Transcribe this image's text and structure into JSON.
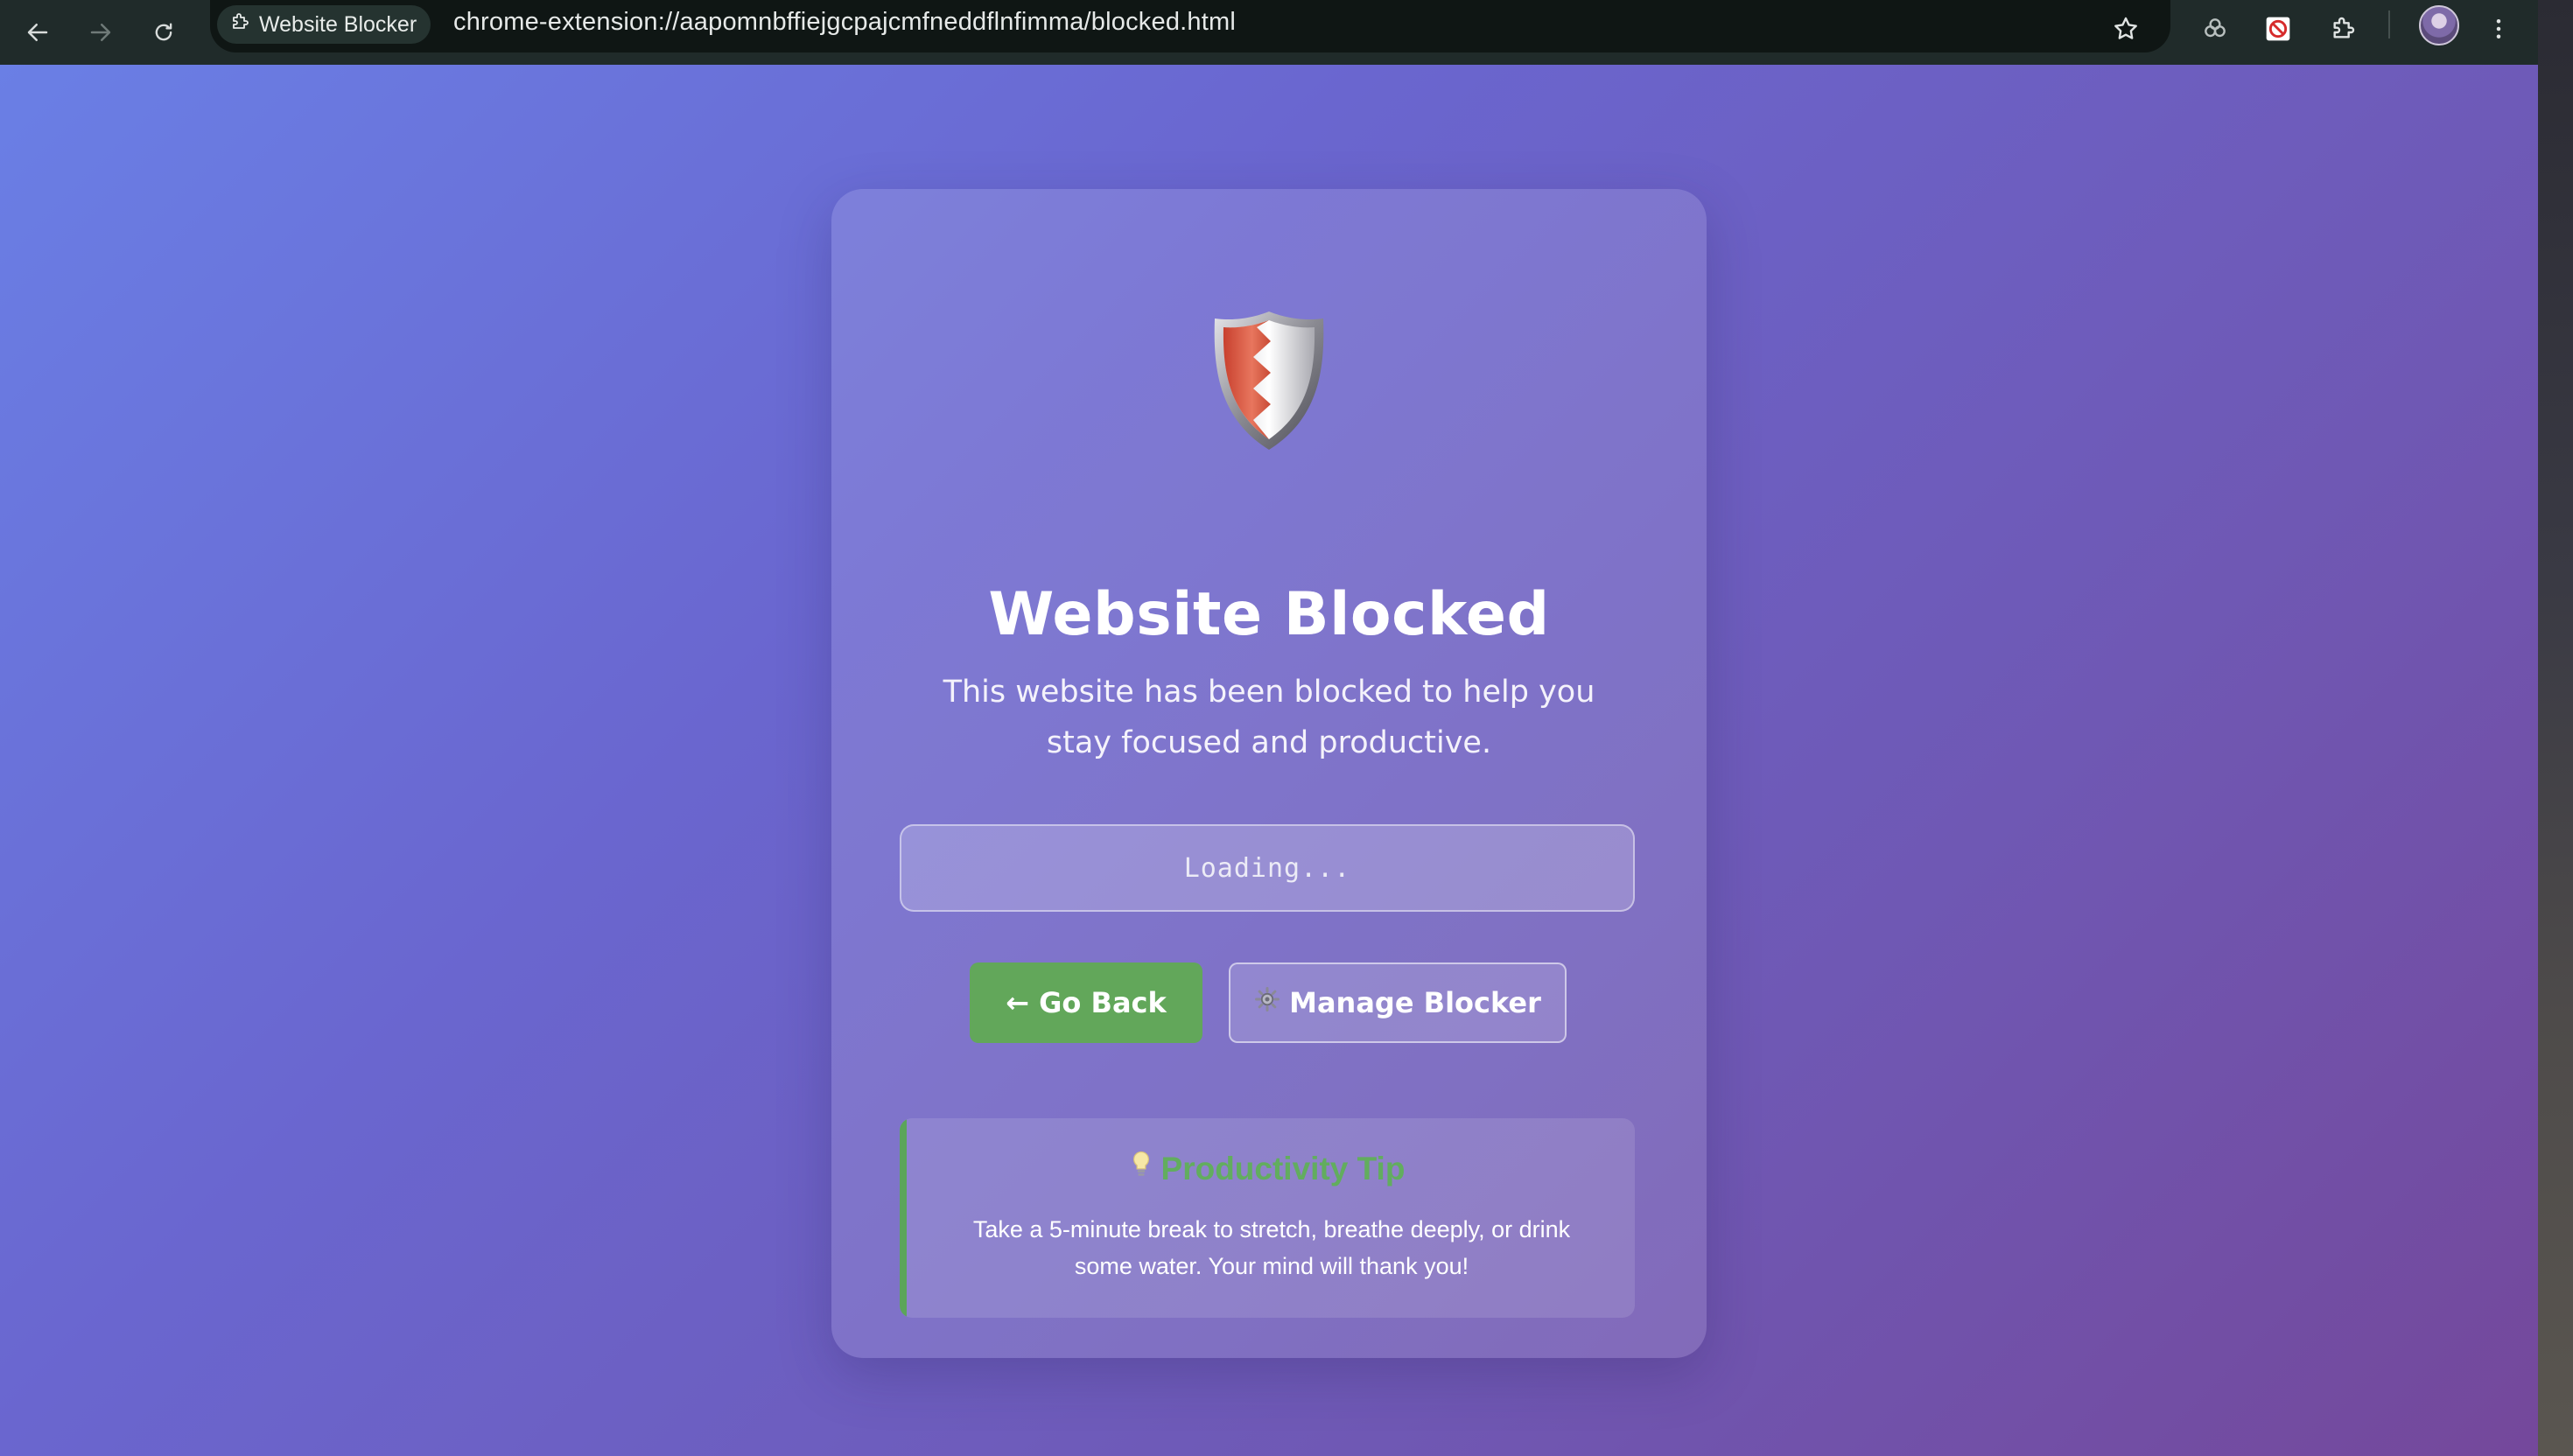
{
  "browser": {
    "tab_chip_label": "Website Blocker",
    "url": "chrome-extension://aapomnbffiejgcpajcmfneddflnfimma/blocked.html",
    "icons": [
      "back-arrow-icon",
      "forward-arrow-icon",
      "reload-icon",
      "extension-puzzle-icon",
      "bookmark-star-icon",
      "sync-icon",
      "blocker-extension-icon",
      "extensions-icon",
      "avatar",
      "more-menu-icon"
    ]
  },
  "blocked_page": {
    "title": "Website Blocked",
    "description": "This website has been blocked to help you stay focused and productive.",
    "blocked_url_text": "Loading...",
    "go_back_label": "← Go Back",
    "manage_label": "Manage Blocker",
    "tip_title": "Productivity Tip",
    "tip_text": "Take a 5-minute break to stretch, breathe deeply, or drink some water. Your mind will thank you!",
    "icons": [
      "shield-icon",
      "gear-icon",
      "lightbulb-icon"
    ]
  },
  "colors": {
    "gradient_start": "#6a7fe5",
    "gradient_end": "#74489b",
    "go_back_button": "#62a75a",
    "tip_accent": "#5ba55a",
    "toolbar": "#202b2a"
  }
}
